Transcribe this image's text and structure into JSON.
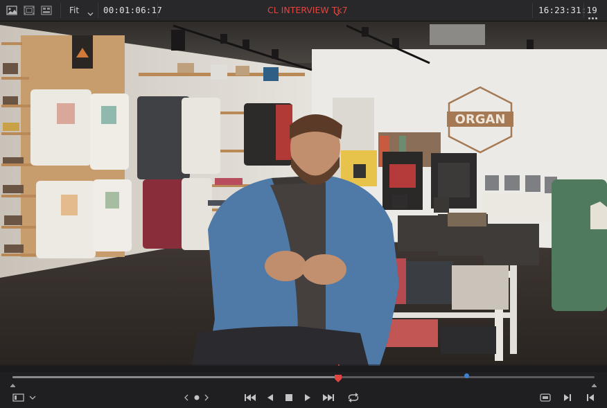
{
  "toolbar": {
    "fit_label": "Fit",
    "timecode": "00:01:06:17",
    "clip_title": "CL INTERVIEW Tk7",
    "clock_timecode": "16:23:31:19",
    "icons": [
      "image-view-icon",
      "film-strip-icon",
      "clip-grid-icon",
      "chevron-down-icon",
      "more-options-icon"
    ]
  },
  "viewer": {
    "scene": "interview-frame",
    "sign_text": "ORGAN",
    "accent_color": "#e0463f"
  },
  "scrubber": {
    "playhead_fraction": 0.56,
    "marker_fraction": 0.78
  },
  "transport": {
    "icons": [
      "viewer-layout-icon",
      "chevron-down-icon",
      "jog-left-icon",
      "jog-dot-icon",
      "jog-right-icon",
      "skip-to-start-icon",
      "play-reverse-icon",
      "stop-icon",
      "play-icon",
      "skip-to-end-icon",
      "loop-icon",
      "match-frame-icon",
      "next-frame-icon",
      "previous-frame-icon"
    ]
  }
}
